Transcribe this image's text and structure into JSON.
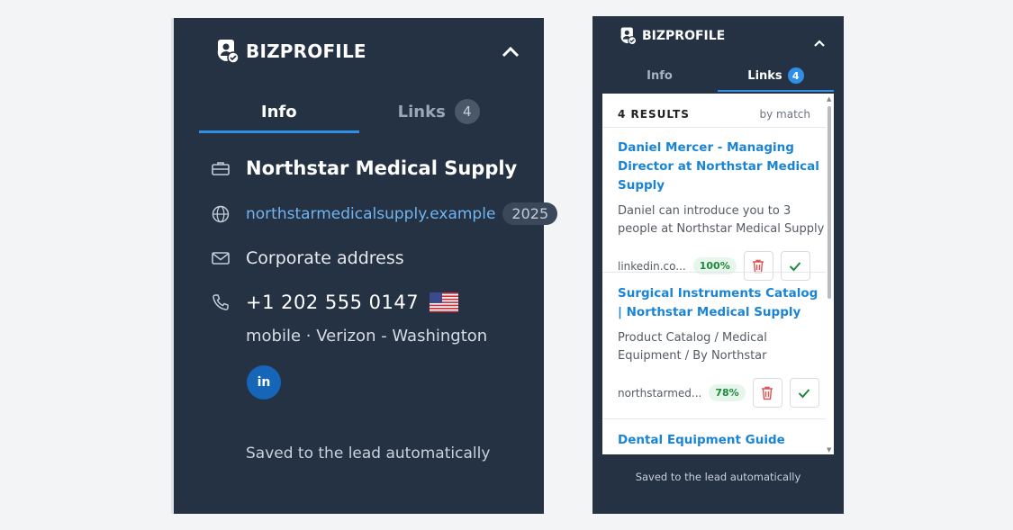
{
  "left": {
    "brand": "BIZPROFILE",
    "tabs": [
      {
        "label": "Info"
      },
      {
        "label": "Links",
        "count": "4"
      }
    ],
    "company": "Northstar Medical Supply",
    "website": "northstarmedicalsupply.example",
    "year": "2025",
    "address": "Corporate address",
    "phone": "+1 202 555 0147",
    "carrier": "mobile · Verizon - Washington",
    "linkedin": "in",
    "saved": "Saved to the lead automatically"
  },
  "right": {
    "brand": "BIZPROFILE",
    "tabs": [
      {
        "label": "Info"
      },
      {
        "label": "Links",
        "count": "4"
      }
    ],
    "results_count": "4 RESULTS",
    "sort": "by match",
    "results": [
      {
        "title": "Daniel Mercer - Managing Director at Northstar Medical Supply",
        "desc": "Daniel can introduce you to 3 people at Northstar Medical Supply",
        "domain": "linkedin.co...",
        "match": "100%"
      },
      {
        "title": "Surgical Instruments Catalog | Northstar Medical Supply",
        "desc": "Product Catalog / Medical Equipment / By Northstar",
        "domain": "northstarmed...",
        "match": "78%"
      },
      {
        "title": "Dental Equipment Guide"
      }
    ],
    "saved": "Saved to the lead automatically"
  },
  "colors": {
    "panel_bg": "#243244",
    "accent": "#2f8fe6",
    "link": "#1a84d6",
    "match_green": "#1e8a3c",
    "delete_red": "#e05252"
  },
  "icons": [
    "logo-icon",
    "chevron-up-icon",
    "briefcase-icon",
    "globe-icon",
    "mail-icon",
    "phone-icon",
    "us-flag-icon",
    "linkedin-icon",
    "trash-icon",
    "check-icon"
  ]
}
